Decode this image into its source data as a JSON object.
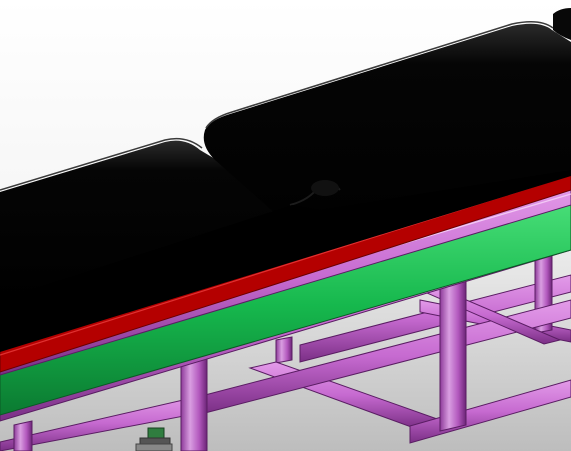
{
  "app": {
    "view": "3d-cad-viewport"
  },
  "colors": {
    "background_top": "#ffffff",
    "background_bottom": "#c9c9c9",
    "belt_cover": "#000000",
    "belt_edge_red": "#b40000",
    "side_rail_green": "#16b84d",
    "frame_purple": "#c66ad0",
    "frame_purple_dark": "#7b2f86",
    "foot_green": "#2f7d3f"
  },
  "model": {
    "components": [
      "black-belt-cover",
      "red-belt-edge",
      "green-side-rail",
      "purple-frame",
      "support-feet"
    ]
  }
}
